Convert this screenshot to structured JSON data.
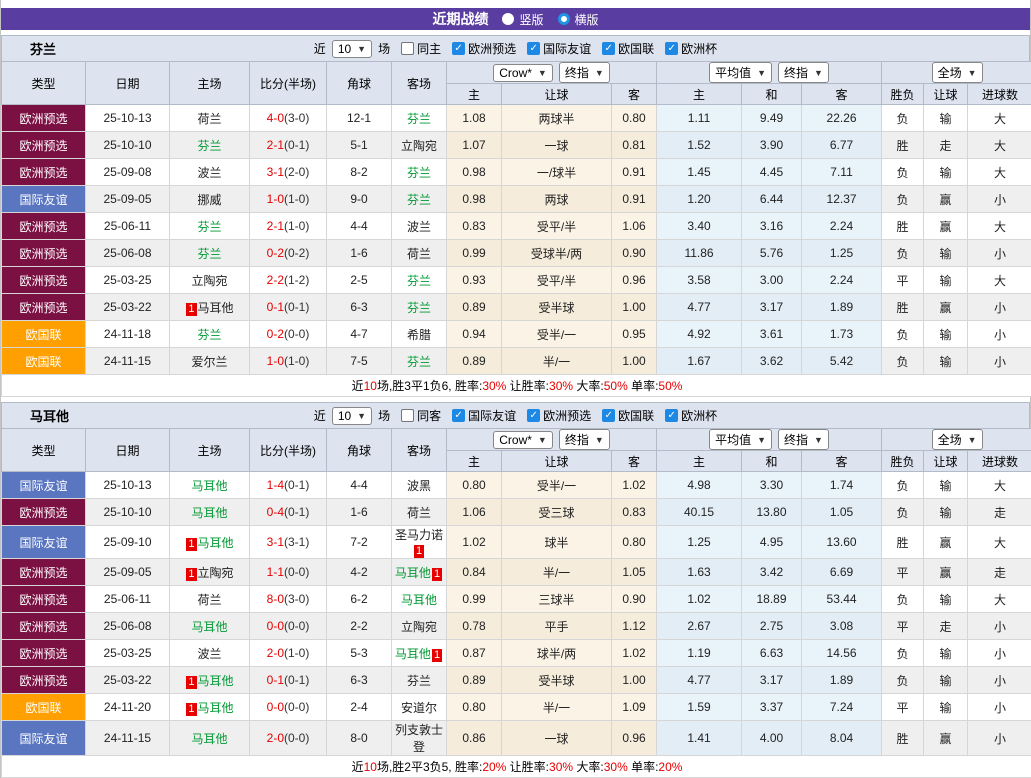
{
  "title_bar": {
    "title": "近期战绩",
    "radio_vertical": "竖版",
    "radio_horizontal": "横版"
  },
  "filter": {
    "near": "近",
    "count": "10",
    "games": "场"
  },
  "header_dropdowns": {
    "asian_company": "Crow*",
    "asian_stage": "终指",
    "euro_company": "平均值",
    "euro_stage": "终指",
    "scope": "全场"
  },
  "table_columns": {
    "fixed": [
      "类型",
      "日期",
      "主场",
      "比分(半场)",
      "角球",
      "客场"
    ],
    "asian": [
      "主",
      "让球",
      "客"
    ],
    "euro": [
      "主",
      "和",
      "客"
    ],
    "result": [
      "胜负",
      "让球",
      "进球数"
    ]
  },
  "colors": {
    "titlebar_purple": "#5a3da0",
    "league_qualifier_maroon": "#7b1043",
    "league_friendly_blue": "#5b76c0",
    "league_nations_orange": "#ffa000",
    "team_highlight_green": "#009933",
    "score_red": "#e60000",
    "win_red": "#e60000",
    "lose_blue": "#2430c8",
    "draw_green": "#008800",
    "checkbox_blue": "#1e88e5",
    "panel_bg": "#dde3ef"
  },
  "teams": [
    {
      "name": "芬兰",
      "same_side": "同主",
      "filters": [
        "欧洲预选",
        "国际友谊",
        "欧国联",
        "欧洲杯"
      ],
      "rows": [
        {
          "lg": "欧洲预选",
          "date": "25-10-13",
          "home": {
            "n": "荷兰"
          },
          "score": "4-0",
          "half": "(3-0)",
          "corner": "12-1",
          "away": {
            "n": "芬兰",
            "g": true
          },
          "ah": [
            "1.08",
            "两球半",
            "0.80"
          ],
          "eu": [
            "1.11",
            "9.49",
            "22.26"
          ],
          "res": [
            "负",
            "输",
            "大"
          ]
        },
        {
          "lg": "欧洲预选",
          "date": "25-10-10",
          "home": {
            "n": "芬兰",
            "g": true
          },
          "score": "2-1",
          "half": "(0-1)",
          "corner": "5-1",
          "away": {
            "n": "立陶宛"
          },
          "ah": [
            "1.07",
            "一球",
            "0.81"
          ],
          "eu": [
            "1.52",
            "3.90",
            "6.77"
          ],
          "res": [
            "胜",
            "走",
            "大"
          ]
        },
        {
          "lg": "欧洲预选",
          "date": "25-09-08",
          "home": {
            "n": "波兰"
          },
          "score": "3-1",
          "half": "(2-0)",
          "corner": "8-2",
          "away": {
            "n": "芬兰",
            "g": true
          },
          "ah": [
            "0.98",
            "一/球半",
            "0.91"
          ],
          "eu": [
            "1.45",
            "4.45",
            "7.11"
          ],
          "res": [
            "负",
            "输",
            "大"
          ]
        },
        {
          "lg": "国际友谊",
          "date": "25-09-05",
          "home": {
            "n": "挪威"
          },
          "score": "1-0",
          "half": "(1-0)",
          "corner": "9-0",
          "away": {
            "n": "芬兰",
            "g": true
          },
          "ah": [
            "0.98",
            "两球",
            "0.91"
          ],
          "eu": [
            "1.20",
            "6.44",
            "12.37"
          ],
          "res": [
            "负",
            "赢",
            "小"
          ]
        },
        {
          "lg": "欧洲预选",
          "date": "25-06-11",
          "home": {
            "n": "芬兰",
            "g": true
          },
          "score": "2-1",
          "half": "(1-0)",
          "corner": "4-4",
          "away": {
            "n": "波兰"
          },
          "ah": [
            "0.83",
            "受平/半",
            "1.06"
          ],
          "eu": [
            "3.40",
            "3.16",
            "2.24"
          ],
          "res": [
            "胜",
            "赢",
            "大"
          ]
        },
        {
          "lg": "欧洲预选",
          "date": "25-06-08",
          "home": {
            "n": "芬兰",
            "g": true
          },
          "score": "0-2",
          "half": "(0-2)",
          "corner": "1-6",
          "away": {
            "n": "荷兰"
          },
          "ah": [
            "0.99",
            "受球半/两",
            "0.90"
          ],
          "eu": [
            "11.86",
            "5.76",
            "1.25"
          ],
          "res": [
            "负",
            "输",
            "小"
          ]
        },
        {
          "lg": "欧洲预选",
          "date": "25-03-25",
          "home": {
            "n": "立陶宛"
          },
          "score": "2-2",
          "half": "(1-2)",
          "corner": "2-5",
          "away": {
            "n": "芬兰",
            "g": true
          },
          "ah": [
            "0.93",
            "受平/半",
            "0.96"
          ],
          "eu": [
            "3.58",
            "3.00",
            "2.24"
          ],
          "res": [
            "平",
            "输",
            "大"
          ]
        },
        {
          "lg": "欧洲预选",
          "date": "25-03-22",
          "home": {
            "n": "马耳他",
            "b1": true
          },
          "score": "0-1",
          "half": "(0-1)",
          "corner": "6-3",
          "away": {
            "n": "芬兰",
            "g": true
          },
          "ah": [
            "0.89",
            "受半球",
            "1.00"
          ],
          "eu": [
            "4.77",
            "3.17",
            "1.89"
          ],
          "res": [
            "胜",
            "赢",
            "小"
          ]
        },
        {
          "lg": "欧国联",
          "date": "24-11-18",
          "home": {
            "n": "芬兰",
            "g": true
          },
          "score": "0-2",
          "half": "(0-0)",
          "corner": "4-7",
          "away": {
            "n": "希腊"
          },
          "ah": [
            "0.94",
            "受半/一",
            "0.95"
          ],
          "eu": [
            "4.92",
            "3.61",
            "1.73"
          ],
          "res": [
            "负",
            "输",
            "小"
          ]
        },
        {
          "lg": "欧国联",
          "date": "24-11-15",
          "home": {
            "n": "爱尔兰"
          },
          "score": "1-0",
          "half": "(1-0)",
          "corner": "7-5",
          "away": {
            "n": "芬兰",
            "g": true
          },
          "ah": [
            "0.89",
            "半/一",
            "1.00"
          ],
          "eu": [
            "1.67",
            "3.62",
            "5.42"
          ],
          "res": [
            "负",
            "输",
            "小"
          ]
        }
      ],
      "summary": [
        {
          "t": "近"
        },
        {
          "t": "10",
          "red": true
        },
        {
          "t": "场,胜3平1负6, 胜率:"
        },
        {
          "t": "30%",
          "red": true
        },
        {
          "t": " 让胜率:"
        },
        {
          "t": "30%",
          "red": true
        },
        {
          "t": " 大率:"
        },
        {
          "t": "50%",
          "red": true
        },
        {
          "t": " 单率:"
        },
        {
          "t": "50%",
          "red": true
        }
      ]
    },
    {
      "name": "马耳他",
      "same_side": "同客",
      "filters": [
        "国际友谊",
        "欧洲预选",
        "欧国联",
        "欧洲杯"
      ],
      "rows": [
        {
          "lg": "国际友谊",
          "date": "25-10-13",
          "home": {
            "n": "马耳他",
            "g": true
          },
          "score": "1-4",
          "half": "(0-1)",
          "corner": "4-4",
          "away": {
            "n": "波黑"
          },
          "ah": [
            "0.80",
            "受半/一",
            "1.02"
          ],
          "eu": [
            "4.98",
            "3.30",
            "1.74"
          ],
          "res": [
            "负",
            "输",
            "大"
          ]
        },
        {
          "lg": "欧洲预选",
          "date": "25-10-10",
          "home": {
            "n": "马耳他",
            "g": true
          },
          "score": "0-4",
          "half": "(0-1)",
          "corner": "1-6",
          "away": {
            "n": "荷兰"
          },
          "ah": [
            "1.06",
            "受三球",
            "0.83"
          ],
          "eu": [
            "40.15",
            "13.80",
            "1.05"
          ],
          "res": [
            "负",
            "输",
            "走"
          ]
        },
        {
          "lg": "国际友谊",
          "date": "25-09-10",
          "home": {
            "n": "马耳他",
            "g": true,
            "b1": true
          },
          "score": "3-1",
          "half": "(3-1)",
          "corner": "7-2",
          "away": {
            "n": "圣马力诺",
            "b2": true
          },
          "ah": [
            "1.02",
            "球半",
            "0.80"
          ],
          "eu": [
            "1.25",
            "4.95",
            "13.60"
          ],
          "res": [
            "胜",
            "赢",
            "大"
          ]
        },
        {
          "lg": "欧洲预选",
          "date": "25-09-05",
          "home": {
            "n": "立陶宛",
            "b1": true
          },
          "score": "1-1",
          "half": "(0-0)",
          "corner": "4-2",
          "away": {
            "n": "马耳他",
            "g": true,
            "b2": true
          },
          "ah": [
            "0.84",
            "半/一",
            "1.05"
          ],
          "eu": [
            "1.63",
            "3.42",
            "6.69"
          ],
          "res": [
            "平",
            "赢",
            "走"
          ]
        },
        {
          "lg": "欧洲预选",
          "date": "25-06-11",
          "home": {
            "n": "荷兰"
          },
          "score": "8-0",
          "half": "(3-0)",
          "corner": "6-2",
          "away": {
            "n": "马耳他",
            "g": true
          },
          "ah": [
            "0.99",
            "三球半",
            "0.90"
          ],
          "eu": [
            "1.02",
            "18.89",
            "53.44"
          ],
          "res": [
            "负",
            "输",
            "大"
          ]
        },
        {
          "lg": "欧洲预选",
          "date": "25-06-08",
          "home": {
            "n": "马耳他",
            "g": true
          },
          "score": "0-0",
          "half": "(0-0)",
          "corner": "2-2",
          "away": {
            "n": "立陶宛"
          },
          "ah": [
            "0.78",
            "平手",
            "1.12"
          ],
          "eu": [
            "2.67",
            "2.75",
            "3.08"
          ],
          "res": [
            "平",
            "走",
            "小"
          ]
        },
        {
          "lg": "欧洲预选",
          "date": "25-03-25",
          "home": {
            "n": "波兰"
          },
          "score": "2-0",
          "half": "(1-0)",
          "corner": "5-3",
          "away": {
            "n": "马耳他",
            "g": true,
            "b2": true
          },
          "ah": [
            "0.87",
            "球半/两",
            "1.02"
          ],
          "eu": [
            "1.19",
            "6.63",
            "14.56"
          ],
          "res": [
            "负",
            "输",
            "小"
          ]
        },
        {
          "lg": "欧洲预选",
          "date": "25-03-22",
          "home": {
            "n": "马耳他",
            "g": true,
            "b1": true
          },
          "score": "0-1",
          "half": "(0-1)",
          "corner": "6-3",
          "away": {
            "n": "芬兰"
          },
          "ah": [
            "0.89",
            "受半球",
            "1.00"
          ],
          "eu": [
            "4.77",
            "3.17",
            "1.89"
          ],
          "res": [
            "负",
            "输",
            "小"
          ]
        },
        {
          "lg": "欧国联",
          "date": "24-11-20",
          "home": {
            "n": "马耳他",
            "g": true,
            "b1": true
          },
          "score": "0-0",
          "half": "(0-0)",
          "corner": "2-4",
          "away": {
            "n": "安道尔"
          },
          "ah": [
            "0.80",
            "半/一",
            "1.09"
          ],
          "eu": [
            "1.59",
            "3.37",
            "7.24"
          ],
          "res": [
            "平",
            "输",
            "小"
          ]
        },
        {
          "lg": "国际友谊",
          "date": "24-11-15",
          "home": {
            "n": "马耳他",
            "g": true
          },
          "score": "2-0",
          "half": "(0-0)",
          "corner": "8-0",
          "away": {
            "n": "列支敦士登"
          },
          "ah": [
            "0.86",
            "一球",
            "0.96"
          ],
          "eu": [
            "1.41",
            "4.00",
            "8.04"
          ],
          "res": [
            "胜",
            "赢",
            "小"
          ]
        }
      ],
      "summary": [
        {
          "t": "近"
        },
        {
          "t": "10",
          "red": true
        },
        {
          "t": "场,胜2平3负5, 胜率:"
        },
        {
          "t": "20%",
          "red": true
        },
        {
          "t": " 让胜率:"
        },
        {
          "t": "30%",
          "red": true
        },
        {
          "t": " 大率:"
        },
        {
          "t": "30%",
          "red": true
        },
        {
          "t": " 单率:"
        },
        {
          "t": "20%",
          "red": true
        }
      ]
    }
  ]
}
